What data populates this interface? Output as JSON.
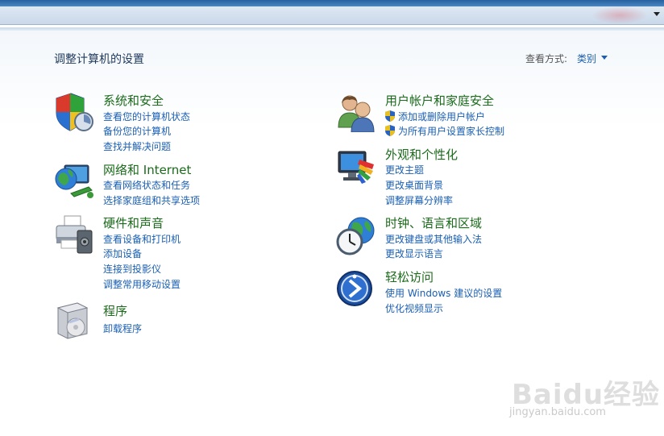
{
  "header": {
    "title": "调整计算机的设置",
    "view_by_label": "查看方式:",
    "view_by_value": "类别"
  },
  "categories": {
    "system": {
      "title": "系统和安全",
      "links": [
        "查看您的计算机状态",
        "备份您的计算机",
        "查找并解决问题"
      ]
    },
    "network": {
      "title": "网络和 Internet",
      "links": [
        "查看网络状态和任务",
        "选择家庭组和共享选项"
      ]
    },
    "hardware": {
      "title": "硬件和声音",
      "links": [
        "查看设备和打印机",
        "添加设备",
        "连接到投影仪",
        "调整常用移动设置"
      ]
    },
    "programs": {
      "title": "程序",
      "links": [
        "卸载程序"
      ]
    },
    "users": {
      "title": "用户帐户和家庭安全",
      "links": [
        "添加或删除用户帐户",
        "为所有用户设置家长控制"
      ]
    },
    "appearance": {
      "title": "外观和个性化",
      "links": [
        "更改主题",
        "更改桌面背景",
        "调整屏幕分辨率"
      ]
    },
    "clock": {
      "title": "时钟、语言和区域",
      "links": [
        "更改键盘或其他输入法",
        "更改显示语言"
      ]
    },
    "access": {
      "title": "轻松访问",
      "links": [
        "使用 Windows 建议的设置",
        "优化视频显示"
      ]
    }
  },
  "watermark": {
    "brand": "Baidu经验",
    "url": "jingyan.baidu.com"
  }
}
